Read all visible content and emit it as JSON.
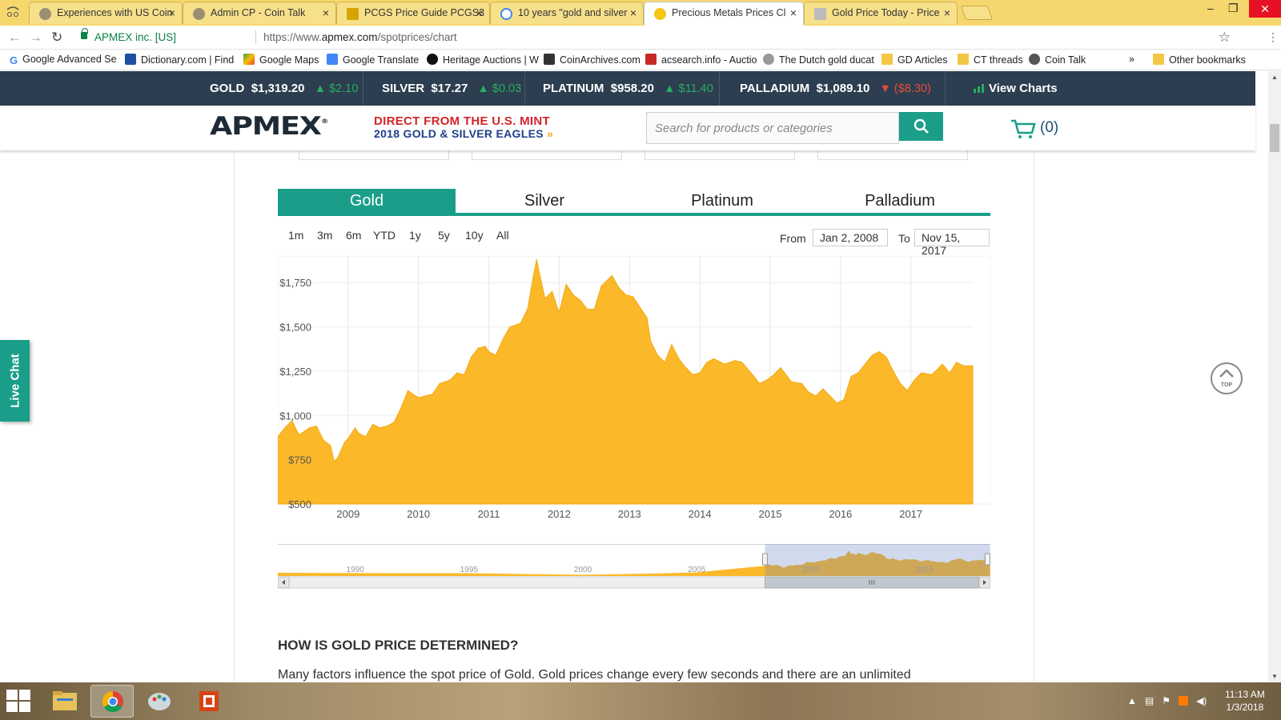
{
  "browser": {
    "tabs": [
      {
        "title": "Experiences with US Coin",
        "active": false
      },
      {
        "title": "Admin CP - Coin Talk",
        "active": false
      },
      {
        "title": "PCGS Price Guide PCGS3",
        "active": false
      },
      {
        "title": "10 years \"gold and silver",
        "active": false
      },
      {
        "title": "Precious Metals Prices Cl",
        "active": true
      },
      {
        "title": "Gold Price Today - Price",
        "active": false
      }
    ],
    "tab_favicon_colors": [
      "#8a8a8a",
      "#8a8a8a",
      "#d6a400",
      "#4285f4",
      "#f5c518",
      "#999999"
    ],
    "tab_close": "×",
    "window_controls": {
      "minimize": "–",
      "restore": "❐",
      "close": "✕"
    },
    "address": {
      "secure_label": "APMEX inc. [US]",
      "url_prefix": "https://www.",
      "url_host": "apmex.com",
      "url_path": "/spotprices/chart"
    },
    "bookmarks": [
      {
        "label": "Google Advanced Se",
        "icon": "google-icon"
      },
      {
        "label": "Dictionary.com | Find",
        "icon": "dictionary-icon"
      },
      {
        "label": "Google Maps",
        "icon": "maps-icon"
      },
      {
        "label": "Google Translate",
        "icon": "translate-icon"
      },
      {
        "label": "Heritage Auctions | W",
        "icon": "heritage-icon"
      },
      {
        "label": "CoinArchives.com",
        "icon": "coinarchives-icon"
      },
      {
        "label": "acsearch.info - Auctio",
        "icon": "acsearch-icon"
      },
      {
        "label": "The Dutch gold ducat",
        "icon": "ducat-icon"
      },
      {
        "label": "GD Articles",
        "icon": "folder-icon"
      },
      {
        "label": "CT threads",
        "icon": "folder-icon"
      },
      {
        "label": "Coin Talk",
        "icon": "cointalk-icon"
      }
    ],
    "bookmarks_overflow": "»",
    "other_bookmarks": "Other bookmarks"
  },
  "ticker": {
    "items": [
      {
        "metal": "GOLD",
        "price": "$1,319.20",
        "change": "$2.10",
        "direction": "up"
      },
      {
        "metal": "SILVER",
        "price": "$17.27",
        "change": "$0.03",
        "direction": "up"
      },
      {
        "metal": "PLATINUM",
        "price": "$958.20",
        "change": "$11.40",
        "direction": "up"
      },
      {
        "metal": "PALLADIUM",
        "price": "$1,089.10",
        "change": "($8.30)",
        "direction": "down"
      }
    ],
    "view_charts": "View Charts",
    "colors": {
      "up": "#27ae60",
      "down": "#e74c3c",
      "bar": "#2c3e50"
    }
  },
  "header": {
    "logo": "APMEX",
    "logo_mark": "®",
    "promo_line1": "DIRECT FROM THE U.S. MINT",
    "promo_line2": "2018 GOLD & SILVER EAGLES",
    "promo_arrows": "»",
    "search_placeholder": "Search for products or categories",
    "cart_count": "(0)",
    "accent": "#1a9e8a"
  },
  "metal_tabs": [
    {
      "label": "Gold",
      "active": true
    },
    {
      "label": "Silver",
      "active": false
    },
    {
      "label": "Platinum",
      "active": false
    },
    {
      "label": "Palladium",
      "active": false
    }
  ],
  "range_buttons": [
    "1m",
    "3m",
    "6m",
    "YTD",
    "1y",
    "5y",
    "10y",
    "All"
  ],
  "date_range": {
    "from_label": "From",
    "from": "Jan 2, 2008",
    "to_label": "To",
    "to": "Nov 15, 2017"
  },
  "chart_data": {
    "type": "area",
    "title": "",
    "xlabel": "",
    "ylabel": "",
    "x_ticks": [
      "2009",
      "2010",
      "2011",
      "2012",
      "2013",
      "2014",
      "2015",
      "2016",
      "2017"
    ],
    "y_ticks": [
      "$500",
      "$750",
      "$1,000",
      "$1,250",
      "$1,500",
      "$1,750"
    ],
    "ylim": [
      500,
      1900
    ],
    "xlim": [
      2008.0,
      2017.88
    ],
    "grid": true,
    "color": "#fbb829",
    "series": [
      {
        "x": [
          2008.0,
          2008.1,
          2008.2,
          2008.3,
          2008.45,
          2008.55,
          2008.65,
          2008.75,
          2008.8,
          2008.85,
          2008.95,
          2009.0,
          2009.1,
          2009.15,
          2009.25,
          2009.35,
          2009.45,
          2009.55,
          2009.65,
          2009.75,
          2009.85,
          2009.92,
          2010.0,
          2010.1,
          2010.2,
          2010.3,
          2010.45,
          2010.55,
          2010.65,
          2010.75,
          2010.85,
          2010.95,
          2011.0,
          2011.1,
          2011.2,
          2011.3,
          2011.45,
          2011.55,
          2011.63,
          2011.68,
          2011.72,
          2011.8,
          2011.9,
          2012.0,
          2012.1,
          2012.2,
          2012.3,
          2012.4,
          2012.5,
          2012.6,
          2012.75,
          2012.85,
          2012.95,
          2013.05,
          2013.15,
          2013.25,
          2013.3,
          2013.4,
          2013.5,
          2013.6,
          2013.7,
          2013.8,
          2013.9,
          2014.0,
          2014.1,
          2014.2,
          2014.35,
          2014.5,
          2014.6,
          2014.75,
          2014.85,
          2014.95,
          2015.05,
          2015.15,
          2015.3,
          2015.45,
          2015.55,
          2015.65,
          2015.75,
          2015.85,
          2015.95,
          2016.05,
          2016.15,
          2016.25,
          2016.35,
          2016.45,
          2016.55,
          2016.65,
          2016.75,
          2016.85,
          2016.95,
          2017.05,
          2017.15,
          2017.3,
          2017.45,
          2017.55,
          2017.65,
          2017.75,
          2017.88
        ],
        "values": [
          880,
          930,
          970,
          890,
          930,
          940,
          860,
          830,
          740,
          760,
          850,
          870,
          930,
          900,
          880,
          950,
          930,
          940,
          960,
          1040,
          1140,
          1120,
          1100,
          1110,
          1120,
          1180,
          1200,
          1240,
          1230,
          1330,
          1380,
          1390,
          1360,
          1340,
          1430,
          1500,
          1520,
          1600,
          1780,
          1880,
          1800,
          1660,
          1700,
          1580,
          1740,
          1680,
          1650,
          1600,
          1600,
          1730,
          1790,
          1720,
          1680,
          1670,
          1610,
          1550,
          1420,
          1340,
          1300,
          1400,
          1320,
          1270,
          1230,
          1240,
          1300,
          1320,
          1290,
          1310,
          1300,
          1230,
          1180,
          1200,
          1230,
          1270,
          1190,
          1180,
          1130,
          1110,
          1150,
          1110,
          1070,
          1090,
          1220,
          1240,
          1290,
          1340,
          1360,
          1330,
          1250,
          1180,
          1140,
          1200,
          1240,
          1230,
          1290,
          1240,
          1300,
          1280,
          1280
        ]
      }
    ],
    "navigator": {
      "x_ticks": [
        "1990",
        "1995",
        "2000",
        "2005",
        "2010",
        "2015"
      ]
    }
  },
  "article": {
    "heading": "HOW IS GOLD PRICE DETERMINED?",
    "paragraph": "Many factors influence the spot price of Gold. Gold prices change every few seconds and there are an unlimited"
  },
  "live_chat": "Live Chat",
  "top_button": "TOP",
  "taskbar": {
    "time": "11:13 AM",
    "date": "1/3/2018"
  }
}
